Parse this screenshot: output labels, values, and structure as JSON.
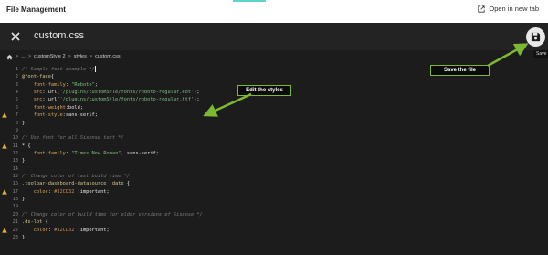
{
  "app": {
    "title": "File Management",
    "open_new_tab": "Open in new tab",
    "accent": "#5cd6cc"
  },
  "editor": {
    "file_name": "custom.css",
    "save_tooltip": "Save",
    "close_icon": "close-icon",
    "save_icon": "floppy-disk-icon"
  },
  "breadcrumb": {
    "items": [
      "...",
      "customStyle 2",
      "styles",
      "custom.css"
    ],
    "separator": ">",
    "home_icon": "home-icon"
  },
  "callouts": {
    "edit": "Edit the styles",
    "save": "Save the file",
    "color": "#7cb832"
  },
  "code": {
    "lines": [
      {
        "n": "1",
        "warn": false,
        "parts": [
          {
            "c": "c-comment",
            "t": "/* Sample font example */"
          }
        ]
      },
      {
        "n": "2",
        "warn": false,
        "parts": [
          {
            "c": "c-at",
            "t": "@font-face"
          },
          {
            "c": "c-white",
            "t": "{"
          }
        ]
      },
      {
        "n": "3",
        "warn": false,
        "parts": [
          {
            "c": "c-prop",
            "t": "    font-family"
          },
          {
            "c": "c-white",
            "t": ": "
          },
          {
            "c": "c-str",
            "t": "\"Roboto\""
          },
          {
            "c": "c-white",
            "t": ";"
          }
        ]
      },
      {
        "n": "4",
        "warn": false,
        "parts": [
          {
            "c": "c-prop",
            "t": "    src"
          },
          {
            "c": "c-white",
            "t": ": url("
          },
          {
            "c": "c-str",
            "t": "'/plugins/customStle/fonts/roboto-regular.eot'"
          },
          {
            "c": "c-white",
            "t": ");"
          }
        ]
      },
      {
        "n": "5",
        "warn": false,
        "parts": [
          {
            "c": "c-prop",
            "t": "    src"
          },
          {
            "c": "c-white",
            "t": ": url("
          },
          {
            "c": "c-str",
            "t": "'/plugins/customStle/fonts/roboto-regular.ttf'"
          },
          {
            "c": "c-white",
            "t": ");"
          }
        ]
      },
      {
        "n": "6",
        "warn": false,
        "parts": [
          {
            "c": "c-prop",
            "t": "    font-weight"
          },
          {
            "c": "c-white",
            "t": ":bold;"
          }
        ]
      },
      {
        "n": "7",
        "warn": true,
        "parts": [
          {
            "c": "c-prop",
            "t": "    font-style"
          },
          {
            "c": "c-white",
            "t": ":sans-serif;"
          }
        ]
      },
      {
        "n": "8",
        "warn": false,
        "parts": [
          {
            "c": "c-white",
            "t": "}"
          }
        ]
      },
      {
        "n": "9",
        "warn": false,
        "parts": []
      },
      {
        "n": "10",
        "warn": false,
        "parts": [
          {
            "c": "c-comment",
            "t": "/* Use font for all Sisense text */"
          }
        ]
      },
      {
        "n": "11",
        "warn": true,
        "parts": [
          {
            "c": "c-white",
            "t": "* {"
          }
        ]
      },
      {
        "n": "12",
        "warn": false,
        "parts": [
          {
            "c": "c-prop",
            "t": "    font-family"
          },
          {
            "c": "c-white",
            "t": ": "
          },
          {
            "c": "c-str",
            "t": "\"Times New Roman\""
          },
          {
            "c": "c-white",
            "t": ", sans-serif;"
          }
        ]
      },
      {
        "n": "13",
        "warn": false,
        "parts": [
          {
            "c": "c-white",
            "t": "}"
          }
        ]
      },
      {
        "n": "14",
        "warn": false,
        "parts": []
      },
      {
        "n": "15",
        "warn": false,
        "parts": [
          {
            "c": "c-comment",
            "t": "/* Change color of last build time */"
          }
        ]
      },
      {
        "n": "16",
        "warn": false,
        "parts": [
          {
            "c": "c-at",
            "t": ".toolbar-dashboard-datasource__date"
          },
          {
            "c": "c-white",
            "t": " {"
          }
        ]
      },
      {
        "n": "17",
        "warn": true,
        "parts": [
          {
            "c": "c-prop",
            "t": "    color"
          },
          {
            "c": "c-white",
            "t": ": "
          },
          {
            "c": "c-num",
            "t": "#32CD32"
          },
          {
            "c": "c-white",
            "t": " !important;"
          }
        ]
      },
      {
        "n": "18",
        "warn": false,
        "parts": [
          {
            "c": "c-white",
            "t": "}"
          }
        ]
      },
      {
        "n": "19",
        "warn": false,
        "parts": []
      },
      {
        "n": "20",
        "warn": false,
        "parts": [
          {
            "c": "c-comment",
            "t": "/* Change color of build time for older versions of Sisense */"
          }
        ]
      },
      {
        "n": "21",
        "warn": false,
        "parts": [
          {
            "c": "c-at",
            "t": ".ds-lbt"
          },
          {
            "c": "c-white",
            "t": " {"
          }
        ]
      },
      {
        "n": "22",
        "warn": true,
        "parts": [
          {
            "c": "c-prop",
            "t": "    color"
          },
          {
            "c": "c-white",
            "t": ": "
          },
          {
            "c": "c-num",
            "t": "#32CD32"
          },
          {
            "c": "c-white",
            "t": " !important;"
          }
        ]
      },
      {
        "n": "23",
        "warn": false,
        "parts": [
          {
            "c": "c-white",
            "t": "}"
          }
        ]
      }
    ]
  }
}
